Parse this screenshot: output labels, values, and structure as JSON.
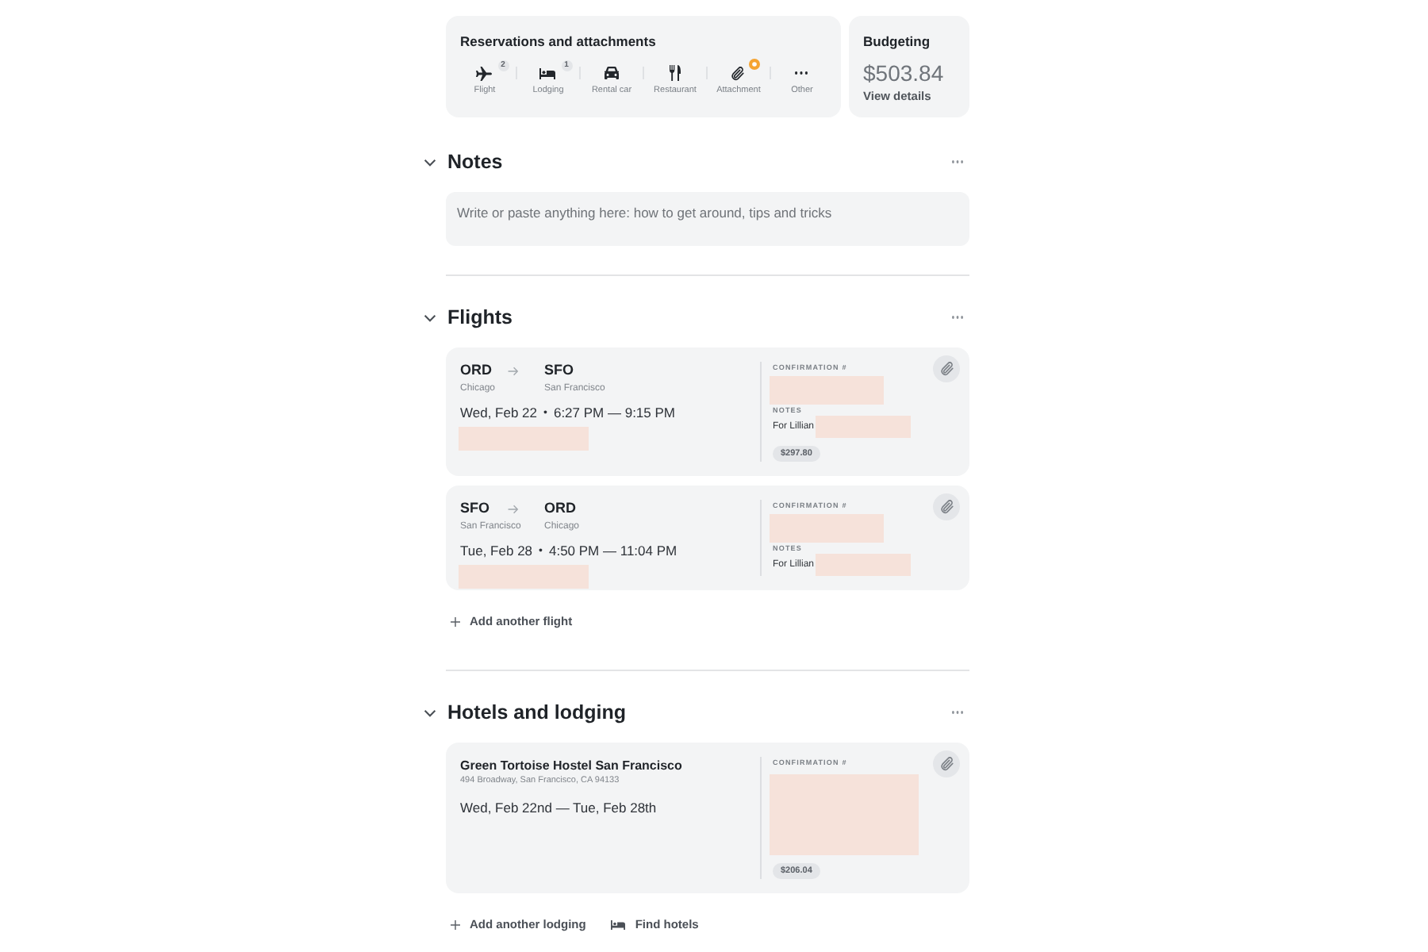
{
  "reservations": {
    "title": "Reservations and attachments",
    "items": [
      {
        "kind": "flight",
        "label": "Flight",
        "count": "2",
        "alert": false
      },
      {
        "kind": "lodging",
        "label": "Lodging",
        "count": "1",
        "alert": false
      },
      {
        "kind": "car",
        "label": "Rental car",
        "alert": false
      },
      {
        "kind": "restaurant",
        "label": "Restaurant",
        "alert": false
      },
      {
        "kind": "attachment",
        "label": "Attachment",
        "alert": true
      },
      {
        "kind": "other",
        "label": "Other",
        "alert": false
      }
    ]
  },
  "budget": {
    "title": "Budgeting",
    "amount": "$503.84",
    "link": "View details"
  },
  "sections": [
    {
      "kind": "notes",
      "title": "Notes",
      "expanded": true,
      "placeholder": "Write or paste anything here: how to get around, tips and tricks"
    },
    {
      "kind": "flights",
      "title": "Flights",
      "expanded": true,
      "flights": [
        {
          "from_code": "ORD",
          "from_city": "Chicago",
          "to_code": "SFO",
          "to_city": "San Francisco",
          "date": "Wed, Feb 22",
          "separator": "•",
          "times": "6:27 PM — 9:15 PM",
          "confirmation_label": "CONFIRMATION #",
          "notes_label": "NOTES",
          "notes": "For Lillian",
          "price": "$297.80"
        },
        {
          "from_code": "SFO",
          "from_city": "San Francisco",
          "to_code": "ORD",
          "to_city": "Chicago",
          "date": "Tue, Feb 28",
          "separator": "•",
          "times": "4:50 PM — 11:04 PM",
          "confirmation_label": "CONFIRMATION #",
          "notes_label": "NOTES",
          "notes": "For Lillian"
        }
      ],
      "actions": [
        {
          "kind": "add",
          "label": "Add another flight"
        }
      ]
    },
    {
      "kind": "lodging",
      "title": "Hotels and lodging",
      "expanded": true,
      "hotels": [
        {
          "name": "Green Tortoise Hostel San Francisco",
          "address": "494 Broadway, San Francisco, CA 94133",
          "dates": "Wed, Feb 22nd — Tue, Feb 28th",
          "confirmation_label": "CONFIRMATION #",
          "price": "$206.04"
        }
      ],
      "actions": [
        {
          "kind": "add",
          "label": "Add another lodging"
        },
        {
          "kind": "find",
          "label": "Find hotels"
        }
      ]
    }
  ]
}
